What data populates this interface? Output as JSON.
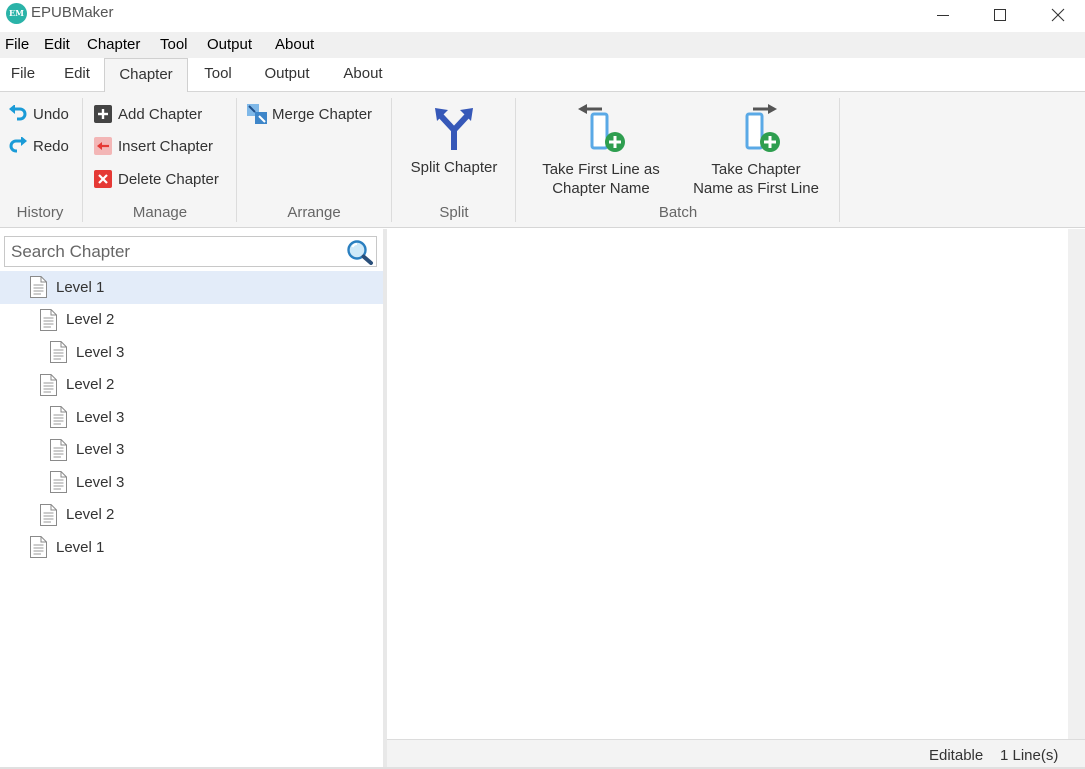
{
  "window": {
    "app_logo_text": "EM",
    "title": "EPUBMaker"
  },
  "menubar": {
    "items": [
      "File",
      "Edit",
      "Chapter",
      "Tool",
      "Output",
      "About"
    ]
  },
  "ribbon_tabs": {
    "items": [
      "File",
      "Edit",
      "Chapter",
      "Tool",
      "Output",
      "About"
    ],
    "active": "Chapter"
  },
  "ribbon": {
    "history": {
      "label": "History",
      "undo": "Undo",
      "redo": "Redo"
    },
    "manage": {
      "label": "Manage",
      "add": "Add Chapter",
      "insert": "Insert Chapter",
      "delete": "Delete Chapter"
    },
    "arrange": {
      "label": "Arrange",
      "merge": "Merge Chapter"
    },
    "split": {
      "label": "Split",
      "split_btn": "Split Chapter"
    },
    "batch": {
      "label": "Batch",
      "first_line_line1": "Take First Line as",
      "first_line_line2": "Chapter Name",
      "chapter_name_line1": "Take Chapter",
      "chapter_name_line2": "Name as First Line"
    },
    "colors": {
      "undo_arrow": "#1a9bd7",
      "delete_red": "#e53935",
      "add_dark": "#444444",
      "plus_green": "#2e9e4f",
      "split_blue": "#3658b8"
    }
  },
  "search": {
    "placeholder": "Search Chapter",
    "value": ""
  },
  "tree": {
    "items": [
      {
        "label": "Level 1",
        "level": 1,
        "selected": true
      },
      {
        "label": "Level 2",
        "level": 2
      },
      {
        "label": "Level 3",
        "level": 3
      },
      {
        "label": "Level 2",
        "level": 2
      },
      {
        "label": "Level 3",
        "level": 3
      },
      {
        "label": "Level 3",
        "level": 3
      },
      {
        "label": "Level 3",
        "level": 3
      },
      {
        "label": "Level 2",
        "level": 2
      },
      {
        "label": "Level 1",
        "level": 1
      }
    ]
  },
  "status": {
    "mode": "Editable",
    "lines": "1 Line(s)"
  }
}
